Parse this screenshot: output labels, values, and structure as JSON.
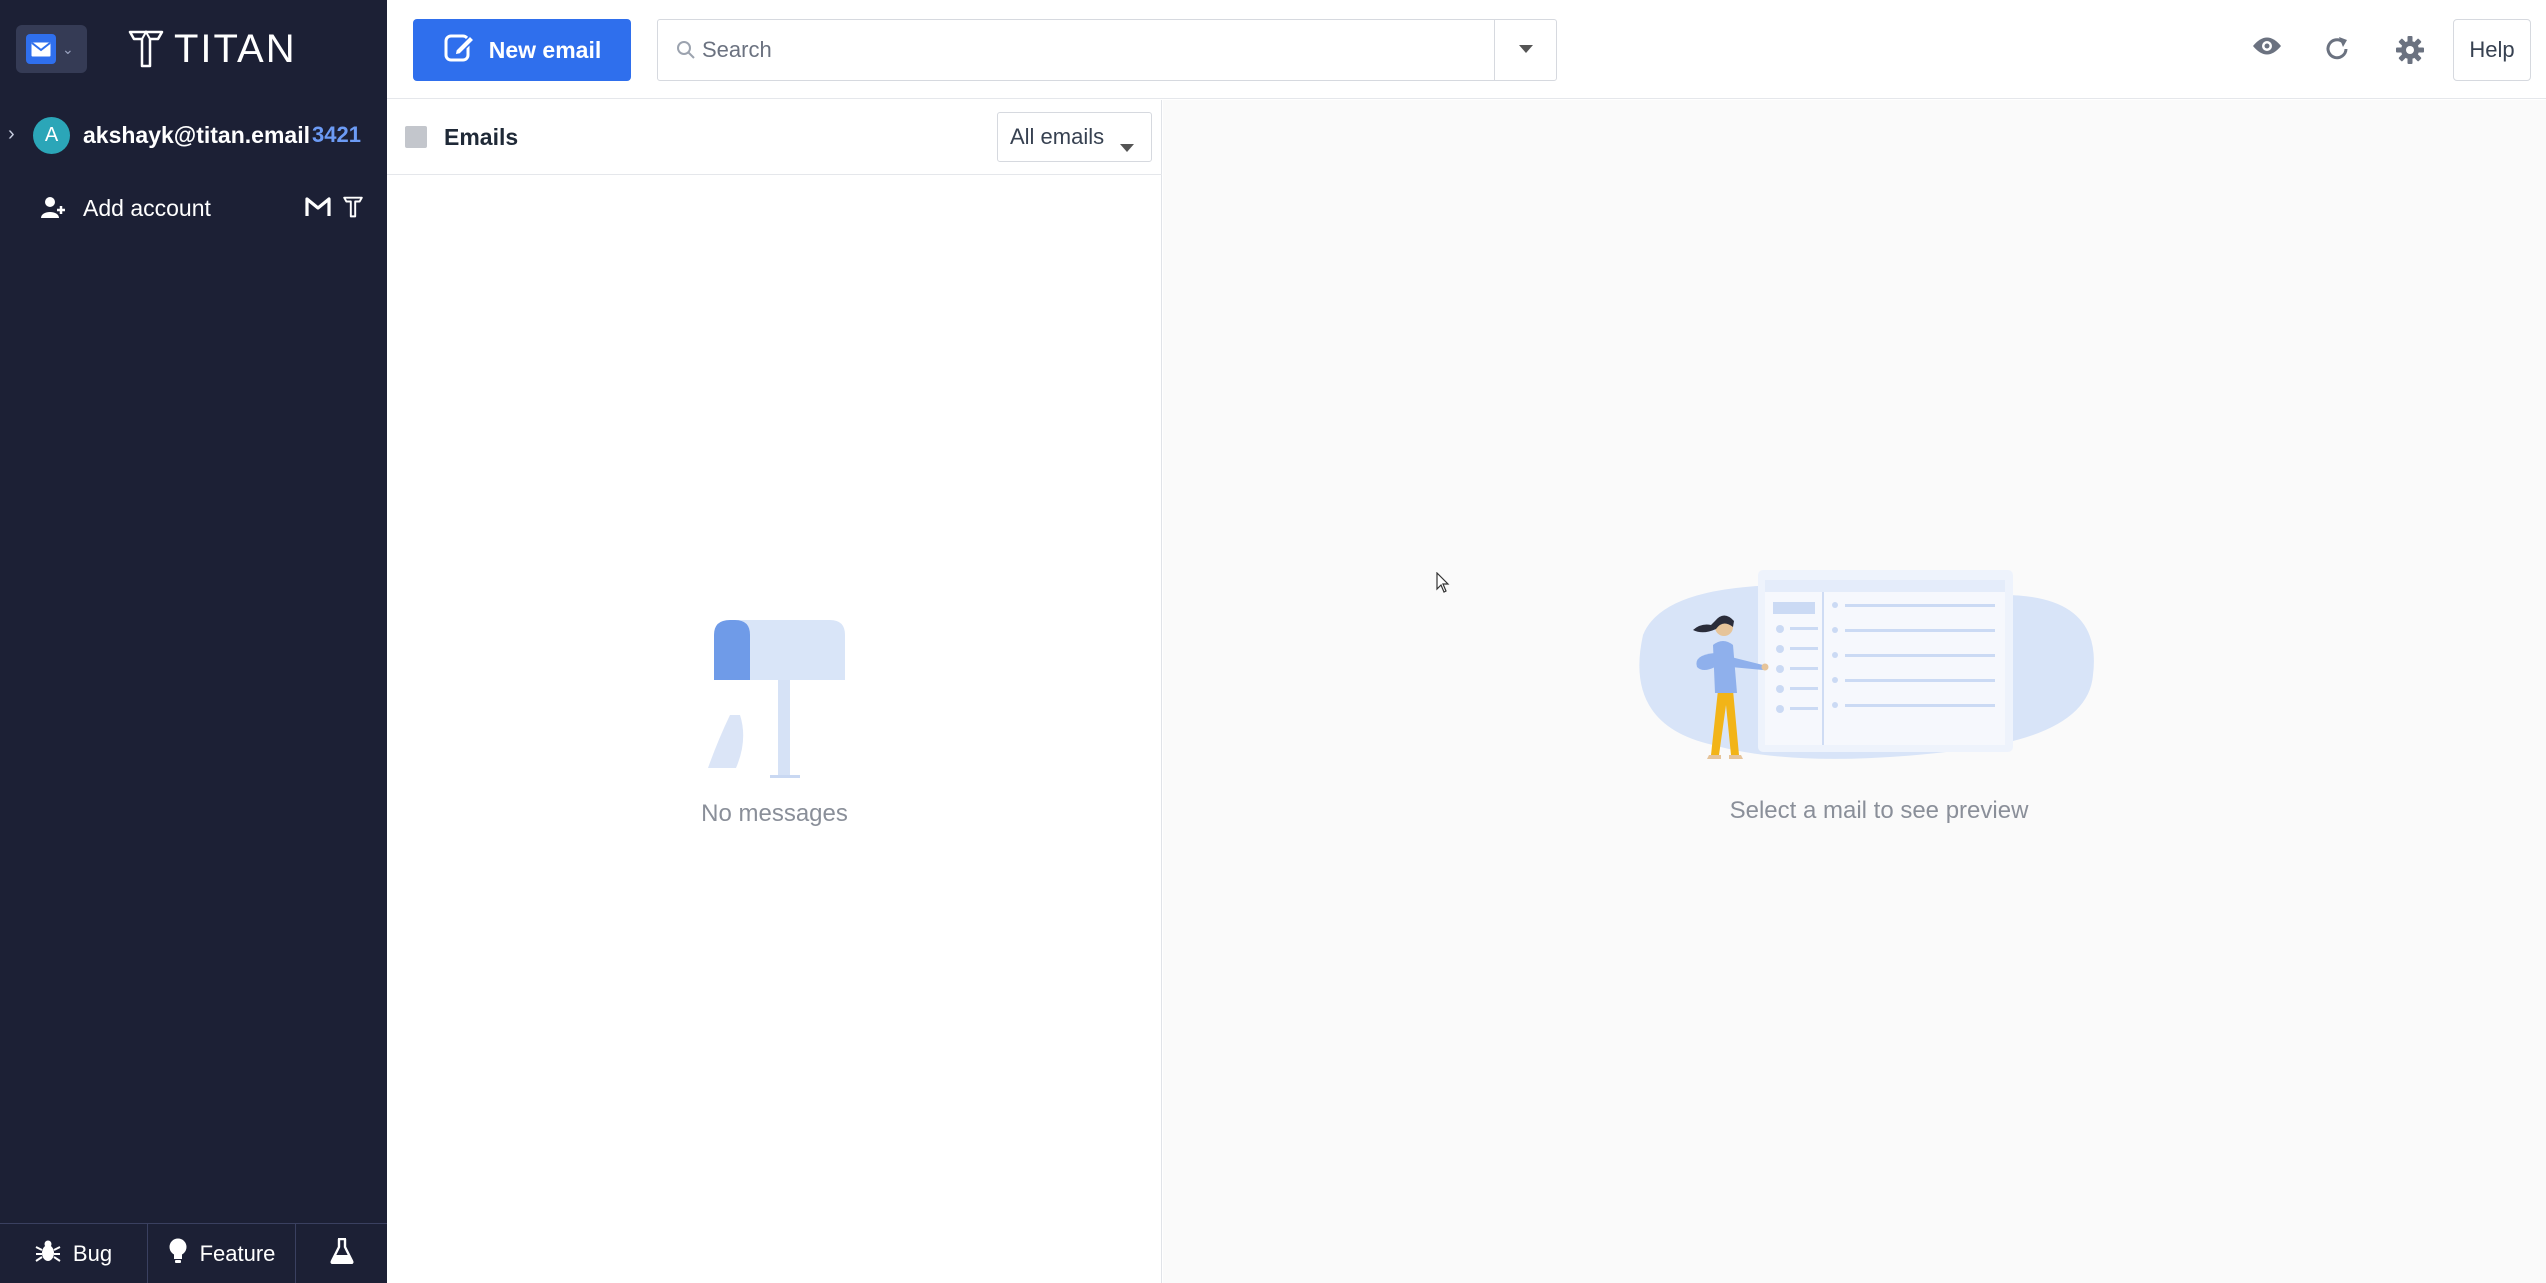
{
  "brand": {
    "name": "TITAN"
  },
  "account": {
    "avatar_letter": "A",
    "email": "akshayk@titan.email",
    "unread_count": "3421"
  },
  "sidebar": {
    "add_account_label": "Add account",
    "footer": {
      "bug_label": "Bug",
      "feature_label": "Feature"
    }
  },
  "toolbar": {
    "new_email_label": "New email",
    "search_placeholder": "Search",
    "help_label": "Help"
  },
  "list": {
    "title": "Emails",
    "filter_selected": "All emails",
    "empty_message": "No messages"
  },
  "preview": {
    "empty_message": "Select a mail to see preview"
  },
  "colors": {
    "sidebar_bg": "#1c2035",
    "accent": "#2f6fed",
    "unread_count": "#6c9bf5"
  }
}
